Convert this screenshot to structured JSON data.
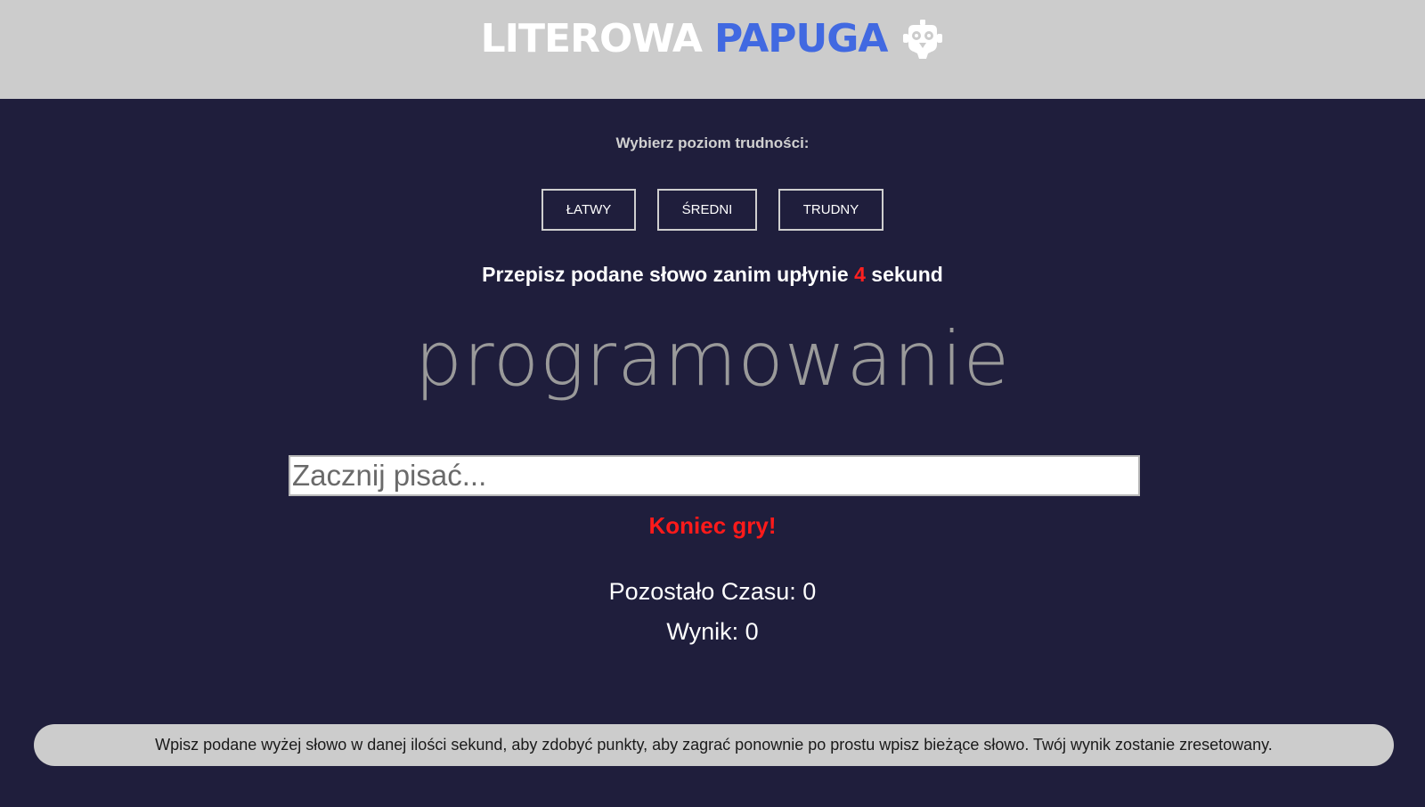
{
  "header": {
    "title_part1": "LITEROWA",
    "title_part2": "PAPUGA",
    "logo_icon": "parrot-robot-icon",
    "accent_color": "#4169e1",
    "background_color": "#cccccc"
  },
  "difficulty": {
    "label": "Wybierz poziom trudności:",
    "levels": [
      {
        "label": "ŁATWY"
      },
      {
        "label": "ŚREDNI"
      },
      {
        "label": "TRUDNY"
      }
    ]
  },
  "instruction": {
    "prefix": "Przepisz podane słowo zanim upłynie",
    "seconds": "4",
    "suffix": "sekund"
  },
  "current_word": "programowanie",
  "input": {
    "value": "",
    "placeholder": "Zacznij pisać..."
  },
  "status": {
    "message": "Koniec gry!",
    "message_color": "#ff1a1a"
  },
  "stats": {
    "time_label": "Pozostało Czasu:",
    "time_value": "0",
    "score_label": "Wynik:",
    "score_value": "0"
  },
  "footer": {
    "text": "Wpisz podane wyżej słowo w danej ilości sekund, aby zdobyć punkty, aby zagrać ponownie po prostu wpisz bieżące słowo. Twój wynik zostanie zresetowany."
  },
  "colors": {
    "page_background": "#1f1e3c"
  }
}
